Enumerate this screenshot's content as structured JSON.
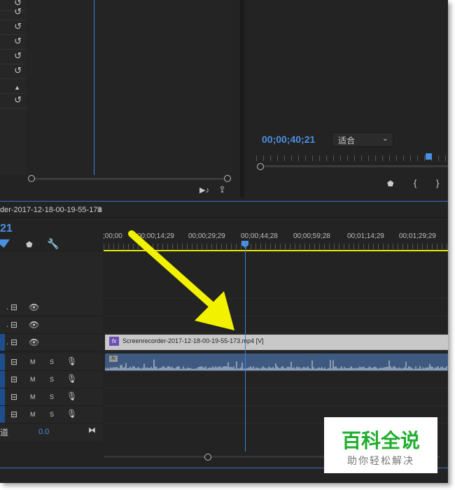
{
  "effect_controls": {
    "reset_icon": "↺",
    "collapse_icon": "▲",
    "rows": [
      "reset",
      "reset",
      "reset",
      "reset",
      "reset",
      "reset",
      "collapse",
      "reset"
    ],
    "export_icons": [
      "▶♪",
      "⇪"
    ]
  },
  "program_monitor": {
    "timecode": "00;00;40;21",
    "fit_label": "适合",
    "fit_chevron": "⌄",
    "transport_icons": [
      "⬟",
      "{",
      "}"
    ]
  },
  "timeline": {
    "sequence_name": "der-2017-12-18-00-19-55-173",
    "menu_icon": "≡",
    "timecode": "21",
    "ruler_labels": [
      ";00;00",
      "00;00;14;29",
      "00;00;29;29",
      "00;00;44;28",
      "00;00;59;28",
      "00;01;14;29",
      "00;01;29;29"
    ],
    "tool_icons": [
      "⬟",
      "🔧"
    ],
    "video_tracks": [
      {
        "lock": "🔒",
        "toggle": "⊟",
        "eye": "👁"
      },
      {
        "lock": "🔒",
        "toggle": "⊟",
        "eye": "👁"
      },
      {
        "lock": "🔒",
        "toggle": "⊟",
        "eye": "👁"
      }
    ],
    "audio_tracks": [
      {
        "m": "M",
        "s": "S",
        "mic": "🎙"
      },
      {
        "m": "M",
        "s": "S",
        "mic": "🎙"
      },
      {
        "m": "M",
        "s": "S",
        "mic": "🎙"
      },
      {
        "m": "M",
        "s": "S",
        "mic": "🎙"
      }
    ],
    "video_clip_label": "Screenrecorder-2017-12-18-00-19-55-173.mp4 [V]",
    "fx_label": "fx",
    "master_label": "道",
    "master_value": "0.0",
    "master_icon": "⧓",
    "arrow_color": "#f2f200"
  },
  "watermark": {
    "title": "百科全说",
    "subtitle": "助你轻松解决"
  }
}
